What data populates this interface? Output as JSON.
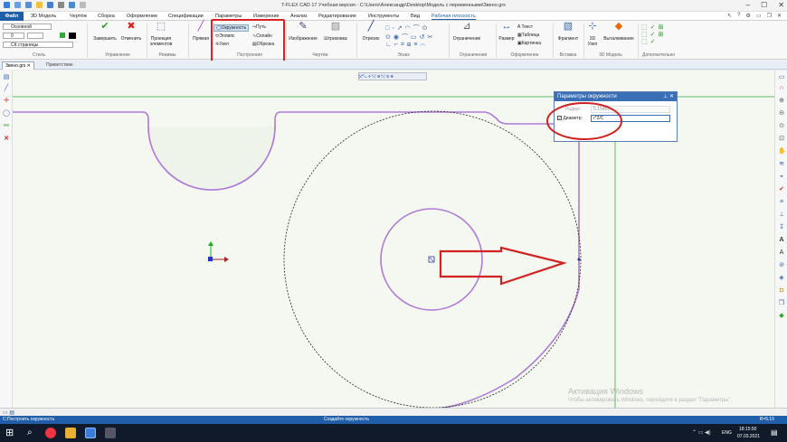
{
  "window": {
    "title": "T-FLEX CAD 17 Учебная версия - C:\\Users\\Александр\\Desktop\\Модель с переменными\\Звено.grs"
  },
  "menu": {
    "file": "Файл",
    "tabs": [
      "3D Модель",
      "Чертёж",
      "Сборка",
      "Оформление",
      "Спецификации",
      "Параметры",
      "Измерение",
      "Анализ",
      "Редактирование",
      "Инструменты",
      "Вид",
      "Рабочая плоскость"
    ]
  },
  "ribbon": {
    "style": {
      "layer": "Основной",
      "level": "0",
      "page": "СК страницы",
      "label": "Стиль"
    },
    "control": {
      "finish": "Завершить",
      "cancel": "Отменить",
      "label": "Управление"
    },
    "modes": {
      "projection": "Проекция элементов",
      "label": "Режимы"
    },
    "construction": {
      "line": "Прямая",
      "circle": "Окружность",
      "ellipse": "Эллипс",
      "node": "Узел",
      "path": "Путь",
      "spline": "Сплайн",
      "cuts": "Обрезка",
      "label": "Построения"
    },
    "drawing": {
      "image": "Изображение",
      "hatch": "Штриховка",
      "label": "Чертёж"
    },
    "sketch": {
      "segment": "Отрезок",
      "label": "Эскиз"
    },
    "constraints": {
      "constraint": "Ограничение",
      "label": "Ограничения"
    },
    "design": {
      "size": "Размер",
      "text": "Текст",
      "table": "Таблица",
      "picture": "Картинка",
      "label": "Оформление"
    },
    "insert": {
      "fragment": "Фрагмент",
      "label": "Вставка"
    },
    "model3d": {
      "node3d": "3D Узел",
      "extrude": "Выталкивание",
      "label": "3D Модель"
    },
    "extra": {
      "label": "Дополнительно"
    }
  },
  "doc_tabs": {
    "doc": "Звено.grs",
    "welcome": "Приветствие"
  },
  "panel": {
    "title": "Параметры окружности",
    "radius_label": "Радиус:",
    "radius_value": "5.15463",
    "diameter_label": "Диаметр:",
    "diameter_value": "r*2/C"
  },
  "watermark": {
    "line1": "Активация Windows",
    "line2": "Чтобы активировать Windows, перейдите в раздел \"Параметры\"."
  },
  "status": {
    "left": "С:Построить окружность",
    "center": "Создайте окружность",
    "right": "R=5.15"
  },
  "taskbar": {
    "lang": "ENG",
    "time": "18:15:50",
    "date": "07.03.2021"
  },
  "colors": {
    "accent": "#1f5ea8",
    "contour": "#b07ad8",
    "annotation": "#d22222",
    "axis_y": "#22aa22",
    "axis_x": "#2233cc"
  }
}
